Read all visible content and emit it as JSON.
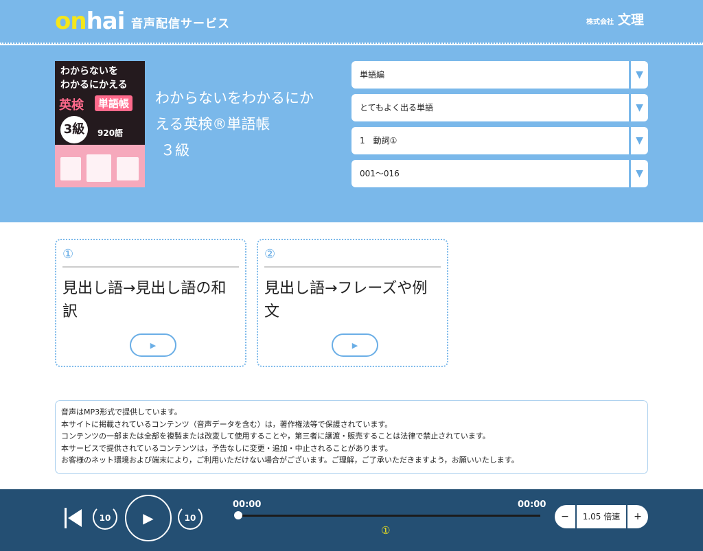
{
  "header": {
    "logo_on": "on",
    "logo_hai": "hai",
    "service_name": "音声配信サービス",
    "company_prefix": "株式会社",
    "company_name": "文理"
  },
  "book": {
    "cover": {
      "line1": "わからないを",
      "line2": "わかるにかえる",
      "eiken": "英検",
      "tango": "単語帳",
      "grade": "3級",
      "count": "920語"
    },
    "title_lines": [
      "わからないをわかるにか",
      "える英検®単語帳",
      "３級"
    ]
  },
  "selects": [
    {
      "label": "単語編"
    },
    {
      "label": "とてもよく出る単語"
    },
    {
      "label": "1　動詞①"
    },
    {
      "label": "001～016"
    }
  ],
  "tracks": [
    {
      "number": "①",
      "title": "見出し語→見出し語の和訳"
    },
    {
      "number": "②",
      "title": "見出し語→フレーズや例文"
    }
  ],
  "notice": [
    "音声はMP3形式で提供しています。",
    "本サイトに掲載されているコンテンツ（音声データを含む）は，著作権法等で保護されています。",
    "コンテンツの一部または全部を複製または改変して使用することや，第三者に譲渡・販売することは法律で禁止されています。",
    "本サービスで提供されているコンテンツは，予告なしに変更・追加・中止されることがあります。",
    "お客様のネット環境および端末により，ご利用いただけない場合がございます。ご理解，ご了承いただきますよう，お願いいたします。"
  ],
  "player": {
    "time_current": "00:00",
    "time_total": "00:00",
    "progress": 0,
    "current_track": "①",
    "rewind_seconds": "10",
    "forward_seconds": "10",
    "speed_minus": "−",
    "speed_plus": "+",
    "speed_value": "1.05 倍速"
  },
  "colors": {
    "header_blue": "#7ab8ea",
    "player_navy": "#244f73",
    "accent_yellow": "#f5e61b"
  }
}
